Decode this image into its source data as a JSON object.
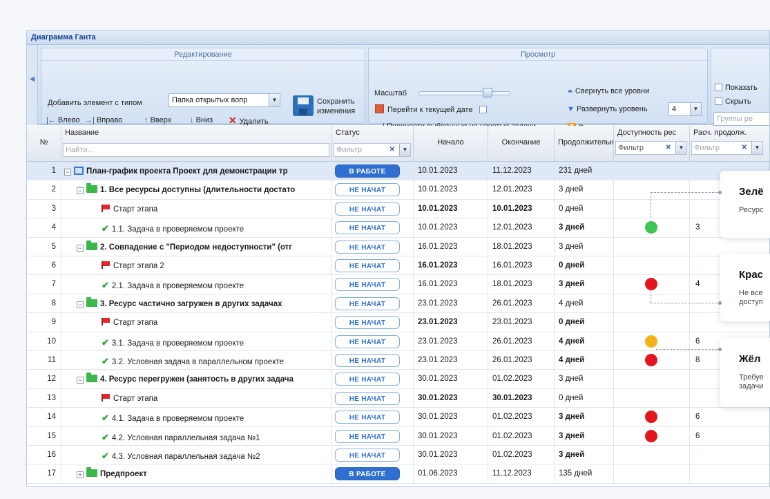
{
  "window": {
    "title": "Диаграмма Ганта"
  },
  "ribbon": {
    "editing": {
      "title": "Редактирование",
      "add_label": "Добавить элемент с типом",
      "type_value": "Папка открытых вопр",
      "save_line1": "Сохранить",
      "save_line2": "изменения",
      "left": "Влево",
      "right": "Вправо",
      "up": "Вверх",
      "down": "Вниз",
      "delete": "Удалить"
    },
    "view": {
      "title": "Просмотр",
      "scale_label": "Масштаб",
      "scale_level": 0.75,
      "goto_today": "Перейти к текущей дате",
      "move_tasks": "Перенести выбранные не начатые задачи",
      "collapse_all": "Свернуть все уровни",
      "expand_level": "Развернуть уровень",
      "expand_level_value": "4",
      "expand_all": "Развернуть все уровни"
    },
    "show": {
      "show_label": "Показать",
      "hide_label": "Скрыть",
      "groups_placeholder": "Группы ре"
    }
  },
  "columns": {
    "num": "№",
    "name": "Название",
    "name_filter_placeholder": "Найти...",
    "status": "Статус",
    "status_filter_placeholder": "Фильтр",
    "start": "Начало",
    "end": "Окончание",
    "duration": "Продолжительн",
    "availability": "Доступность рес",
    "availability_filter_placeholder": "Фильтр",
    "calc_duration": "Расч. продолж.",
    "calc_filter_placeholder": "Фильтр"
  },
  "rows": [
    {
      "n": "1",
      "name": "План-график проекта Проект для демонстрации тр",
      "status": "В РАБОТЕ",
      "start": "10.01.2023",
      "end": "11.12.2023",
      "dur": "231 дней",
      "avail": "",
      "calc": ""
    },
    {
      "n": "2",
      "name": "1. Все ресурсы доступны (длительности достато",
      "status": "НЕ НАЧАТ",
      "start": "10.01.2023",
      "end": "12.01.2023",
      "dur": "3 дней",
      "avail": "",
      "calc": ""
    },
    {
      "n": "3",
      "name": "Старт этапа",
      "status": "НЕ НАЧАТ",
      "start": "10.01.2023",
      "end": "10.01.2023",
      "dur": "0 дней",
      "avail": "",
      "calc": ""
    },
    {
      "n": "4",
      "name": "1.1. Задача в проверяемом проекте",
      "status": "НЕ НАЧАТ",
      "start": "10.01.2023",
      "end": "12.01.2023",
      "dur": "3 дней",
      "avail": "green",
      "calc": "3"
    },
    {
      "n": "5",
      "name": "2. Совпадение с \"Периодом недоступности\" (отг",
      "status": "НЕ НАЧАТ",
      "start": "16.01.2023",
      "end": "18.01.2023",
      "dur": "3 дней",
      "avail": "",
      "calc": ""
    },
    {
      "n": "6",
      "name": "Старт этапа 2",
      "status": "НЕ НАЧАТ",
      "start": "16.01.2023",
      "end": "16.01.2023",
      "dur": "0 дней",
      "avail": "",
      "calc": ""
    },
    {
      "n": "7",
      "name": "2.1. Задача в проверяемом проекте",
      "status": "НЕ НАЧАТ",
      "start": "16.01.2023",
      "end": "18.01.2023",
      "dur": "3 дней",
      "avail": "red",
      "calc": "4"
    },
    {
      "n": "8",
      "name": "3. Ресурс частично загружен в других задачах",
      "status": "НЕ НАЧАТ",
      "start": "23.01.2023",
      "end": "26.01.2023",
      "dur": "4 дней",
      "avail": "",
      "calc": ""
    },
    {
      "n": "9",
      "name": "Старт этапа",
      "status": "НЕ НАЧАТ",
      "start": "23.01.2023",
      "end": "23.01.2023",
      "dur": "0 дней",
      "avail": "",
      "calc": ""
    },
    {
      "n": "10",
      "name": "3.1. Задача в проверяемом проекте",
      "status": "НЕ НАЧАТ",
      "start": "23.01.2023",
      "end": "26.01.2023",
      "dur": "4 дней",
      "avail": "yellow",
      "calc": "6"
    },
    {
      "n": "11",
      "name": "3.2. Условная задача в параллельном проекте",
      "status": "НЕ НАЧАТ",
      "start": "23.01.2023",
      "end": "26.01.2023",
      "dur": "4 дней",
      "avail": "red",
      "calc": "8"
    },
    {
      "n": "12",
      "name": "4. Ресурс перегружен (занятость в других задача",
      "status": "НЕ НАЧАТ",
      "start": "30.01.2023",
      "end": "01.02.2023",
      "dur": "3 дней",
      "avail": "",
      "calc": ""
    },
    {
      "n": "13",
      "name": "Старт этапа",
      "status": "НЕ НАЧАТ",
      "start": "30.01.2023",
      "end": "30.01.2023",
      "dur": "0 дней",
      "avail": "",
      "calc": ""
    },
    {
      "n": "14",
      "name": "4.1. Задача в проверяемом проекте",
      "status": "НЕ НАЧАТ",
      "start": "30.01.2023",
      "end": "01.02.2023",
      "dur": "3 дней",
      "avail": "red",
      "calc": "6"
    },
    {
      "n": "15",
      "name": "4.2. Условная параллельная задача №1",
      "status": "НЕ НАЧАТ",
      "start": "30.01.2023",
      "end": "01.02.2023",
      "dur": "3 дней",
      "avail": "red",
      "calc": "6"
    },
    {
      "n": "16",
      "name": "4.3. Условная параллельная задача №2",
      "status": "НЕ НАЧАТ",
      "start": "30.01.2023",
      "end": "01.02.2023",
      "dur": "3 дней",
      "avail": "",
      "calc": ""
    },
    {
      "n": "17",
      "name": "Предпроект",
      "status": "В РАБОТЕ",
      "start": "01.06.2023",
      "end": "11.12.2023",
      "dur": "135 дней",
      "avail": "",
      "calc": ""
    }
  ],
  "legend": [
    {
      "title": "Зелё",
      "text1": "Ресурс",
      "text2": ""
    },
    {
      "title": "Крас",
      "text1": "Не все",
      "text2": "доступ"
    },
    {
      "title": "Жёл",
      "text1": "Требуе",
      "text2": "задачи"
    }
  ],
  "colors": {
    "green": "#3fc552",
    "red": "#e3161d",
    "yellow": "#f4b318",
    "accent": "#2f6fd0"
  }
}
